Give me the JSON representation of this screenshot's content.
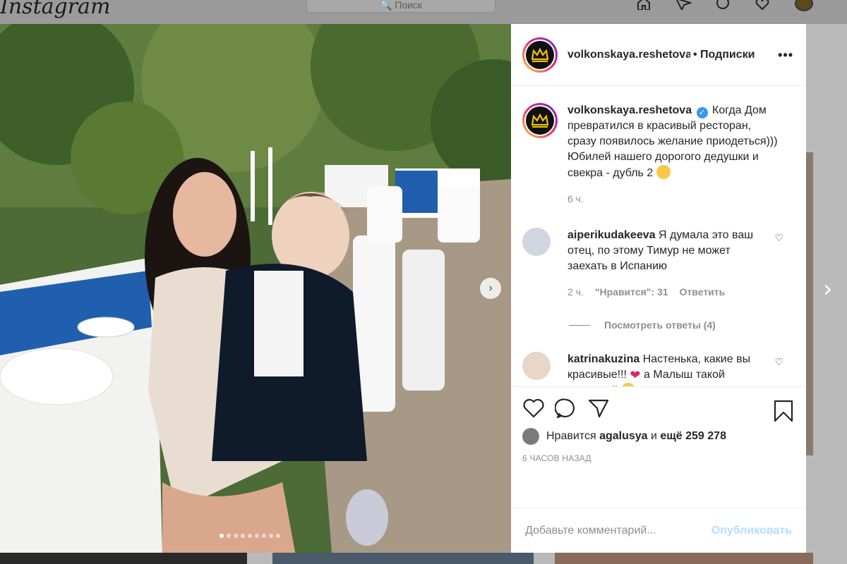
{
  "app": {
    "logo_text": "Instagram",
    "search_placeholder": "Поиск",
    "nav_icons": [
      "home-icon",
      "direct-icon",
      "explore-icon",
      "heart-icon"
    ]
  },
  "post": {
    "author": "volkonskaya.reshetova",
    "follow_label": "• Подписки",
    "more_label": "•••",
    "caption": "Когда Дом превратился в красивый ресторан, сразу появилось желание приодеться))) Юбилей нашего дорогого дедушки и свекра - дубль 2",
    "caption_time": "6 ч.",
    "photo_count": 9,
    "active_photo": 1,
    "likes": {
      "prefix": "Нравится",
      "user": "agalusya",
      "connector": "и",
      "others": "ещё 259 278"
    },
    "posted_ago": "6 ЧАСОВ НАЗАД"
  },
  "comments": [
    {
      "user": "aiperikudakeeva",
      "text": "Я думала это ваш отец, по этому Тимур не может заехать в Испанию",
      "time": "2 ч.",
      "likes_label": "\"Нравится\": 31",
      "reply_label": "Ответить",
      "view_replies": "Посмотреть ответы (4)"
    },
    {
      "user": "katrinakuzina",
      "text_part1": "Настенька, какие вы красивые!!!",
      "text_part2": "а Малыш такой стильный"
    }
  ],
  "composer": {
    "placeholder": "Добавьте комментарий...",
    "publish_label": "Опубликовать"
  },
  "colors": {
    "accent": "#3897f0",
    "publish_disabled": "#b2dffc",
    "meta_gray": "#8e8e8e"
  }
}
